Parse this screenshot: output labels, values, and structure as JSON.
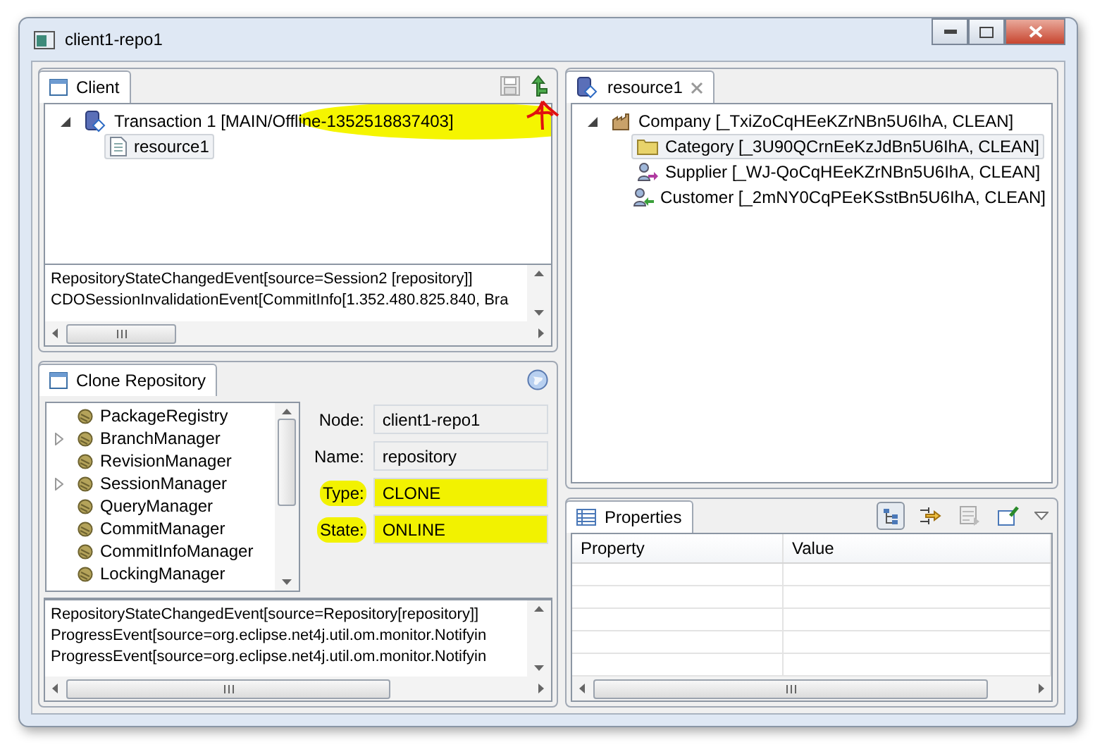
{
  "window": {
    "title": "client1-repo1"
  },
  "client_view": {
    "tab": {
      "label": "Client",
      "selected": true
    },
    "tree": [
      {
        "label": "Transaction 1 [MAIN/Offline-1352518837403]",
        "kind": "transaction",
        "highlighted": true,
        "expanded": true,
        "selected": false,
        "children": [
          {
            "label": "resource1",
            "kind": "resource",
            "selected": true
          }
        ]
      }
    ],
    "log": [
      "RepositoryStateChangedEvent[source=Session2 [repository]]",
      "CDOSessionInvalidationEvent[CommitInfo[1.352.480.825.840, Bra"
    ]
  },
  "clone_view": {
    "tab": {
      "label": "Clone Repository",
      "selected": true
    },
    "tree": [
      {
        "label": "PackageRegistry",
        "expandable": false
      },
      {
        "label": "BranchManager",
        "expandable": true
      },
      {
        "label": "RevisionManager",
        "expandable": false
      },
      {
        "label": "SessionManager",
        "expandable": true
      },
      {
        "label": "QueryManager",
        "expandable": false
      },
      {
        "label": "CommitManager",
        "expandable": false
      },
      {
        "label": "CommitInfoManager",
        "expandable": false
      },
      {
        "label": "LockingManager",
        "expandable": false
      }
    ],
    "fields": [
      {
        "label": "Node:",
        "value": "client1-repo1",
        "highlighted": false
      },
      {
        "label": "Name:",
        "value": "repository",
        "highlighted": false
      },
      {
        "label": "Type:",
        "value": "CLONE",
        "highlighted": true
      },
      {
        "label": "State:",
        "value": "ONLINE",
        "highlighted": true
      }
    ],
    "log": [
      "RepositoryStateChangedEvent[source=Repository[repository]]",
      "ProgressEvent[source=org.eclipse.net4j.util.om.monitor.Notifyin",
      "ProgressEvent[source=org.eclipse.net4j.util.om.monitor.Notifyin"
    ]
  },
  "editor": {
    "tab": {
      "label": "resource1",
      "selected": true
    },
    "tree": [
      {
        "label": "Company [_TxiZoCqHEeKZrNBn5U6IhA, CLEAN]",
        "kind": "company",
        "expanded": true,
        "selected": false,
        "children": [
          {
            "label": "Category [_3U90QCrnEeKzJdBn5U6IhA, CLEAN]",
            "kind": "category",
            "selected": true
          },
          {
            "label": "Supplier [_WJ-QoCqHEeKZrNBn5U6IhA, CLEAN]",
            "kind": "supplier",
            "selected": false
          },
          {
            "label": "Customer [_2mNY0CqPEeKSstBn5U6IhA, CLEAN]",
            "kind": "customer",
            "selected": false
          }
        ]
      }
    ]
  },
  "properties": {
    "tab": {
      "label": "Properties",
      "selected": true
    },
    "tools": [
      {
        "kind": "tree",
        "pressed": true
      },
      {
        "kind": "advanced",
        "pressed": false
      },
      {
        "kind": "restore",
        "pressed": false
      },
      {
        "kind": "pin",
        "pressed": false
      }
    ],
    "columns": [
      "Property",
      "Value"
    ]
  }
}
